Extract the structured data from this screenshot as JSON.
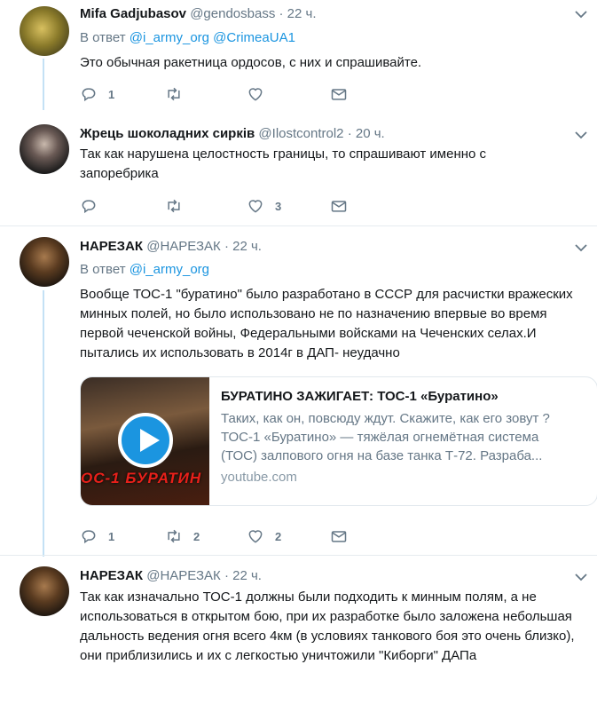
{
  "tweets": [
    {
      "name": "Mifa Gadjubasov",
      "handle": "@gendosbass",
      "time": "· 22 ч.",
      "reply_prefix": "В ответ",
      "reply_mentions": "@i_army_org @CrimeaUA1",
      "text": "Это обычная ракетница ордосов, с них и спрашивайте.",
      "replies": "1",
      "retweets": "",
      "likes": ""
    },
    {
      "name": "Жрець шоколадних сирків",
      "handle": "@Ilostcontrol2",
      "time": "· 20 ч.",
      "text": "Так как нарушена целостность границы, то спрашивают именно с запоребрика",
      "replies": "",
      "retweets": "",
      "likes": "3"
    },
    {
      "name": "НАРЕЗАК",
      "handle": "@НАРЕЗАК",
      "time": "· 22 ч.",
      "reply_prefix": "В ответ",
      "reply_mentions": "@i_army_org",
      "text": "Вообще ТОС-1 \"буратино\" было разработано в СССР для расчистки вражеских минных полей, но было использовано не по назначению впервые во время первой чеченской войны, Федеральными войсками на Чеченских селах.И пытались их использовать в 2014г в ДАП- неудачно",
      "card": {
        "thumb_text": "ОС-1 БУРАТИН",
        "title": "БУРАТИНО ЗАЖИГАЕТ: ТОС-1 «Буратино»",
        "description": "Таких, как он, повсюду ждут. Скажите, как его зовут ? ТОС-1 «Буратино» — тяжёлая огнемётная система (ТОС) залпового огня на базе танка Т-72. Разраба...",
        "domain": "youtube.com"
      },
      "replies": "1",
      "retweets": "2",
      "likes": "2"
    },
    {
      "name": "НАРЕЗАК",
      "handle": "@НАРЕЗАК",
      "time": "· 22 ч.",
      "text": "Так как изначально ТОС-1 должны были подходить к минным полям, а не использоваться в открытом бою, при их разработке было заложена небольшая дальность ведения огня всего 4км (в условиях танкового боя это очень близко), они приблизились  и их с легкостью уничтожили \"Киборги\" ДАПа"
    }
  ],
  "icons": {
    "reply": "reply-icon",
    "retweet": "retweet-icon",
    "like": "like-icon",
    "dm": "direct-message-icon",
    "caret": "chevron-down-icon"
  },
  "colors": {
    "link": "#1b95e0",
    "secondary_text": "#657786",
    "thread_line": "#c4e1f5"
  }
}
